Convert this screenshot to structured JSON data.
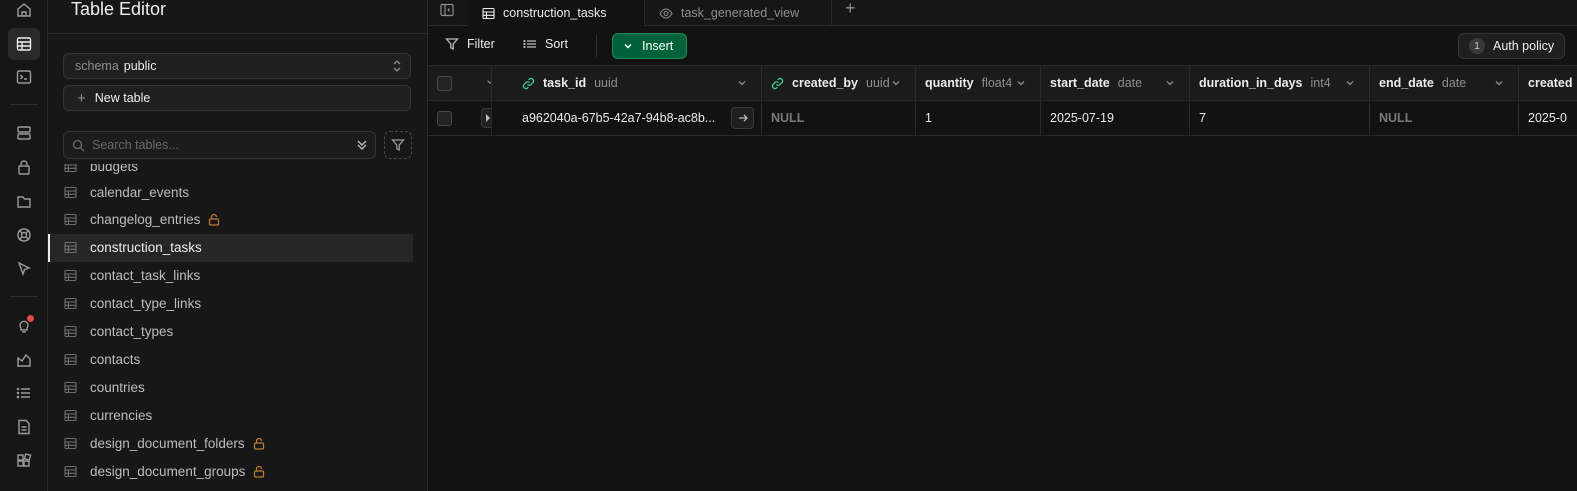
{
  "sidebar": {
    "title": "Table Editor",
    "schema": {
      "prefix": "schema",
      "value": "public"
    },
    "new_table_label": "New table",
    "search_placeholder": "Search tables...",
    "partial_item": "budgets",
    "items": [
      {
        "label": "calendar_events",
        "locked": false
      },
      {
        "label": "changelog_entries",
        "locked": true
      },
      {
        "label": "construction_tasks",
        "locked": false,
        "active": true
      },
      {
        "label": "contact_task_links",
        "locked": false
      },
      {
        "label": "contact_type_links",
        "locked": false
      },
      {
        "label": "contact_types",
        "locked": false
      },
      {
        "label": "contacts",
        "locked": false
      },
      {
        "label": "countries",
        "locked": false
      },
      {
        "label": "currencies",
        "locked": false
      },
      {
        "label": "design_document_folders",
        "locked": true
      },
      {
        "label": "design_document_groups",
        "locked": true
      }
    ]
  },
  "tabs": [
    {
      "label": "construction_tasks",
      "icon": "table-icon",
      "active": true
    },
    {
      "label": "task_generated_view",
      "icon": "eye-icon",
      "active": false
    }
  ],
  "toolbar": {
    "filter_label": "Filter",
    "sort_label": "Sort",
    "insert_label": "Insert",
    "auth_count": "1",
    "auth_label": "Auth policy"
  },
  "columns": [
    {
      "name": "task_id",
      "type": "uuid",
      "fk": true
    },
    {
      "name": "created_by",
      "type": "uuid",
      "fk": true
    },
    {
      "name": "quantity",
      "type": "float4",
      "fk": false
    },
    {
      "name": "start_date",
      "type": "date",
      "fk": false
    },
    {
      "name": "duration_in_days",
      "type": "int4",
      "fk": false
    },
    {
      "name": "end_date",
      "type": "date",
      "fk": false
    },
    {
      "name": "created",
      "type": "",
      "fk": false
    }
  ],
  "row": {
    "task_id": "a962040a-67b5-42a7-94b8-ac8b...",
    "created_by": "NULL",
    "quantity": "1",
    "start_date": "2025-07-19",
    "duration_in_days": "7",
    "end_date": "NULL",
    "created": "2025-0"
  },
  "colors": {
    "accent_green": "#3ecf8e",
    "insert_bg": "#006239",
    "lock_orange": "#c27b2e",
    "notification_red": "#e5484d"
  }
}
